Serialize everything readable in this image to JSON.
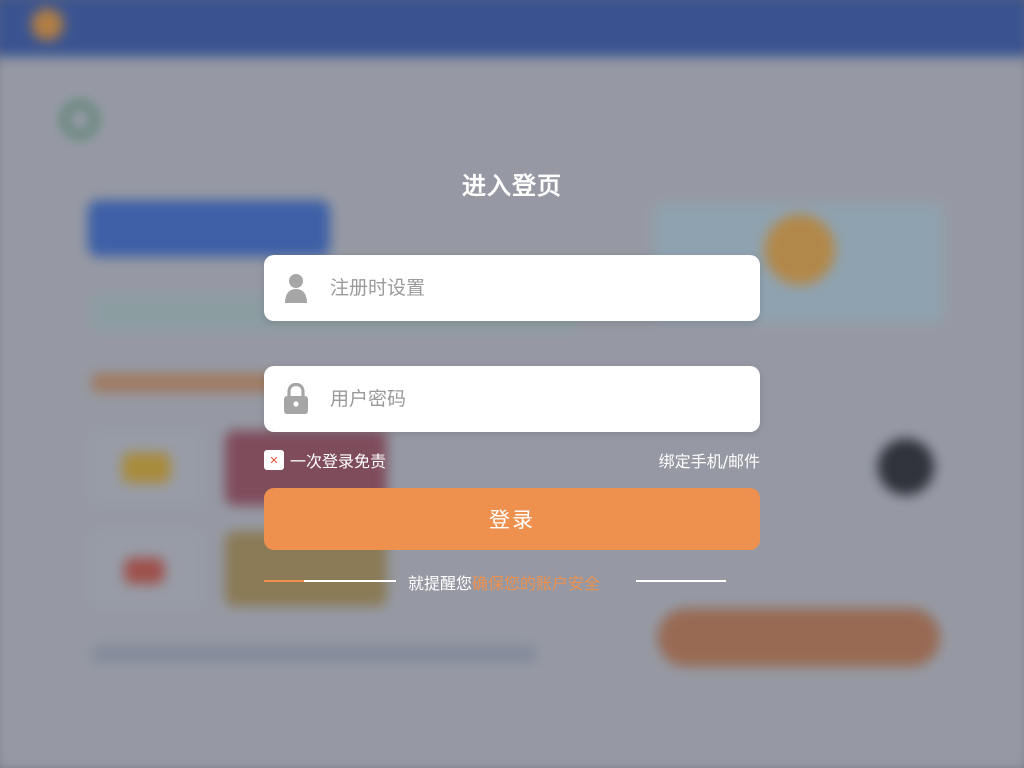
{
  "dialog": {
    "title": "进入登页",
    "username": {
      "placeholder": "注册时设置",
      "icon": "user-icon"
    },
    "password": {
      "placeholder": "用户密码",
      "icon": "lock-icon"
    },
    "remember": {
      "label": "一次登录免责",
      "checked": true
    },
    "bind_link": "绑定手机/邮件",
    "login_button": "登录",
    "hint": {
      "prefix": "就提醒您",
      "highlight": "确保您的账户安全"
    }
  },
  "colors": {
    "accent": "#ee914f",
    "topbar": "#3a5fb6",
    "field_bg": "#ffffff"
  }
}
